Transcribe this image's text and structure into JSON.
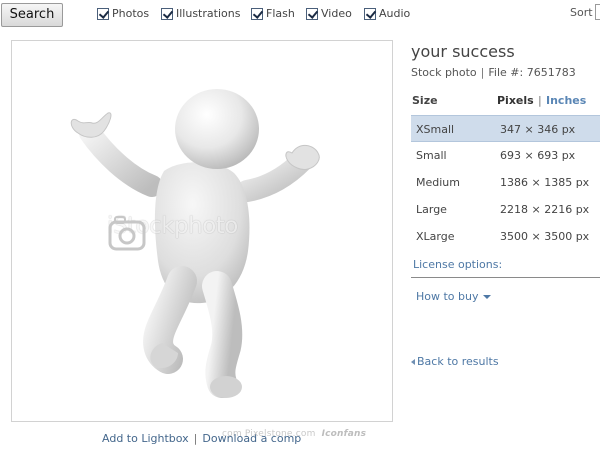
{
  "topbar": {
    "search_label": "Search",
    "filters": [
      {
        "label": "Photos",
        "checked": true
      },
      {
        "label": "Illustrations",
        "checked": true
      },
      {
        "label": "Flash",
        "checked": true
      },
      {
        "label": "Video",
        "checked": true
      },
      {
        "label": "Audio",
        "checked": true
      }
    ],
    "sort_label": "Sort"
  },
  "image": {
    "watermark_text": "iStockphoto",
    "watermark_icon": "istockphoto-logo",
    "add_to_lightbox": "Add to Lightbox",
    "download_comp": "Download a comp",
    "separator": "|",
    "site_mark": "com Pixelstone.com",
    "site_logo_text": "Iconfans"
  },
  "details": {
    "title": "your success",
    "type": "Stock photo",
    "separator": "|",
    "file_number": "File #: 7651783",
    "size_header": "Size",
    "pixels_header": "Pixels",
    "unit_separator": "|",
    "inches_header": "Inches",
    "sizes": [
      {
        "name": "XSmall",
        "dimensions": "347 × 346 px",
        "selected": true
      },
      {
        "name": "Small",
        "dimensions": "693 × 693 px",
        "selected": false
      },
      {
        "name": "Medium",
        "dimensions": "1386 × 1385 px",
        "selected": false
      },
      {
        "name": "Large",
        "dimensions": "2218 × 2216 px",
        "selected": false
      },
      {
        "name": "XLarge",
        "dimensions": "3500 × 3500 px",
        "selected": false
      }
    ],
    "license_options": "License options:",
    "how_to_buy": "How to buy",
    "back_to_results": "Back to results"
  },
  "colors": {
    "link": "#4e78a5",
    "selected_row": "#cfdceb",
    "figure_light": "#f4f4f4",
    "figure_shadow": "#b8b8b8"
  }
}
